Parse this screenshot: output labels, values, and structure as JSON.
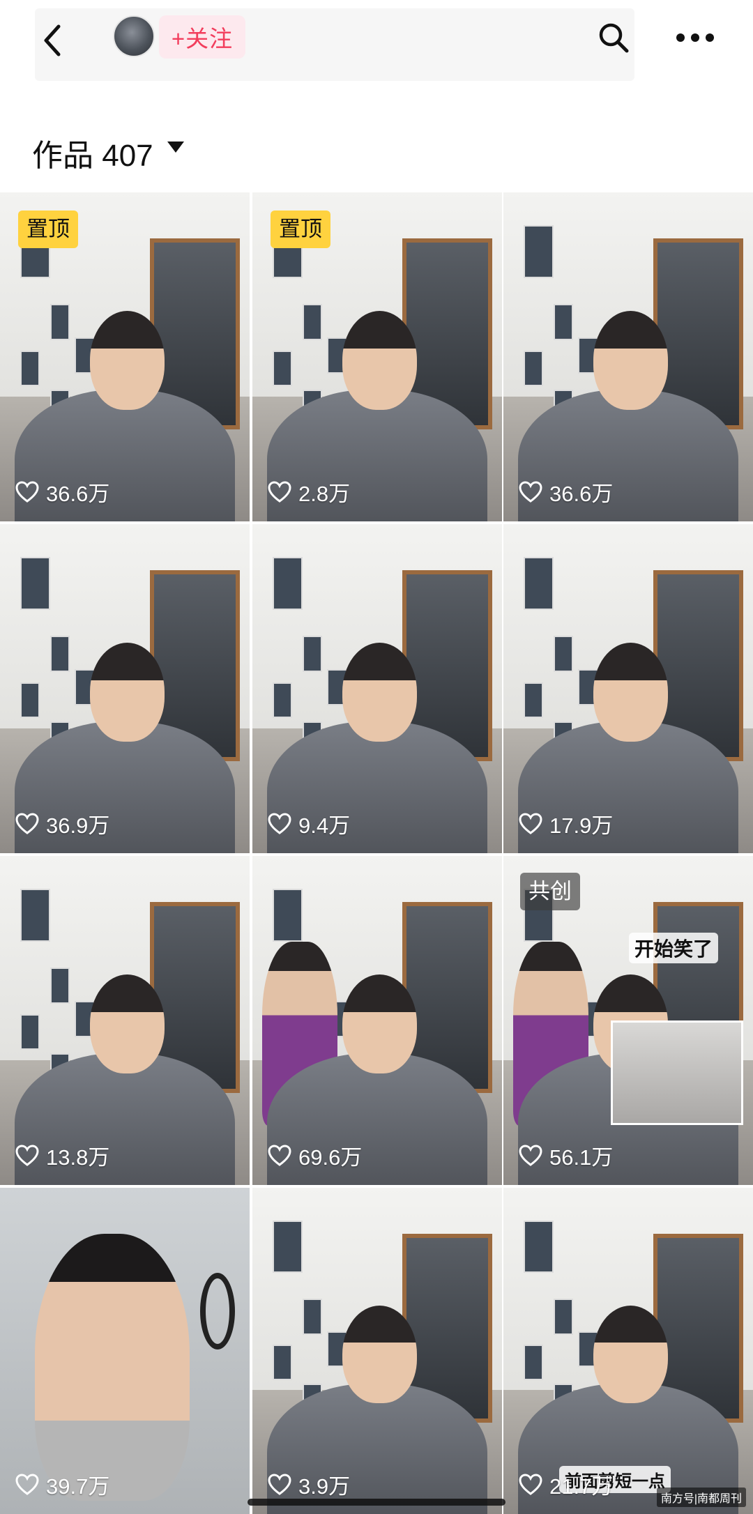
{
  "header": {
    "follow_label": "+关注",
    "icons": {
      "back": "back-chevron-icon",
      "search": "search-icon",
      "more": "more-dots-icon"
    }
  },
  "works": {
    "label": "作品 407"
  },
  "grid": [
    {
      "likes": "36.6万",
      "badge": "置顶",
      "badge_type": "pin",
      "caption": ""
    },
    {
      "likes": "2.8万",
      "badge": "置顶",
      "badge_type": "pin",
      "caption": ""
    },
    {
      "likes": "36.6万",
      "badge": "",
      "badge_type": "",
      "caption": ""
    },
    {
      "likes": "36.9万",
      "badge": "",
      "badge_type": "",
      "caption": ""
    },
    {
      "likes": "9.4万",
      "badge": "",
      "badge_type": "",
      "caption": ""
    },
    {
      "likes": "17.9万",
      "badge": "",
      "badge_type": "",
      "caption": ""
    },
    {
      "likes": "13.8万",
      "badge": "",
      "badge_type": "",
      "caption": ""
    },
    {
      "likes": "69.6万",
      "badge": "",
      "badge_type": "",
      "caption": ""
    },
    {
      "likes": "56.1万",
      "badge": "共创",
      "badge_type": "co",
      "caption": "开始笑了"
    },
    {
      "likes": "39.7万",
      "badge": "",
      "badge_type": "",
      "caption": ""
    },
    {
      "likes": "3.9万",
      "badge": "",
      "badge_type": "",
      "caption": ""
    },
    {
      "likes": "21.7万",
      "badge": "",
      "badge_type": "",
      "caption": "前面剪短一点"
    }
  ],
  "watermark": "南方号|南都周刊",
  "colors": {
    "follow_text": "#f23d5c",
    "follow_bg": "#fde9ee",
    "pin_badge": "#ffd23f"
  }
}
